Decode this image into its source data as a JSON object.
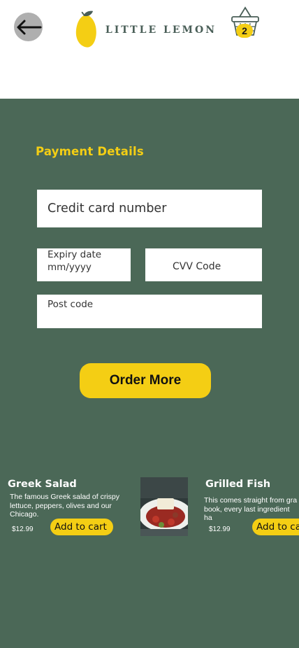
{
  "header": {
    "logo_text": "LITTLE LEMON",
    "cart_count": "2"
  },
  "payment": {
    "title": "Payment Details",
    "card_placeholder": "Credit card number",
    "expiry_placeholder_line1": "Expiry date",
    "expiry_placeholder_line2": "mm/yyyy",
    "cvv_placeholder": "CVV Code",
    "postcode_placeholder": "Post code"
  },
  "order_more_label": "Order More",
  "menu": [
    {
      "name": "Greek Salad",
      "description": "The famous Greek salad of crispy lettuce, peppers, olives and our Chicago.",
      "price": "$12.99",
      "add_label": "Add to cart"
    },
    {
      "name": "Grilled Fish",
      "description": "This comes straight from gra book, every last ingredient ha",
      "price": "$12.99",
      "add_label": "Add to ca"
    }
  ],
  "colors": {
    "primary_green": "#4b6857",
    "lemon_yellow": "#f4ce14",
    "logo_text": "#495e57"
  },
  "icons": [
    "arrow-left-icon",
    "lemon-logo-icon",
    "basket-icon"
  ]
}
